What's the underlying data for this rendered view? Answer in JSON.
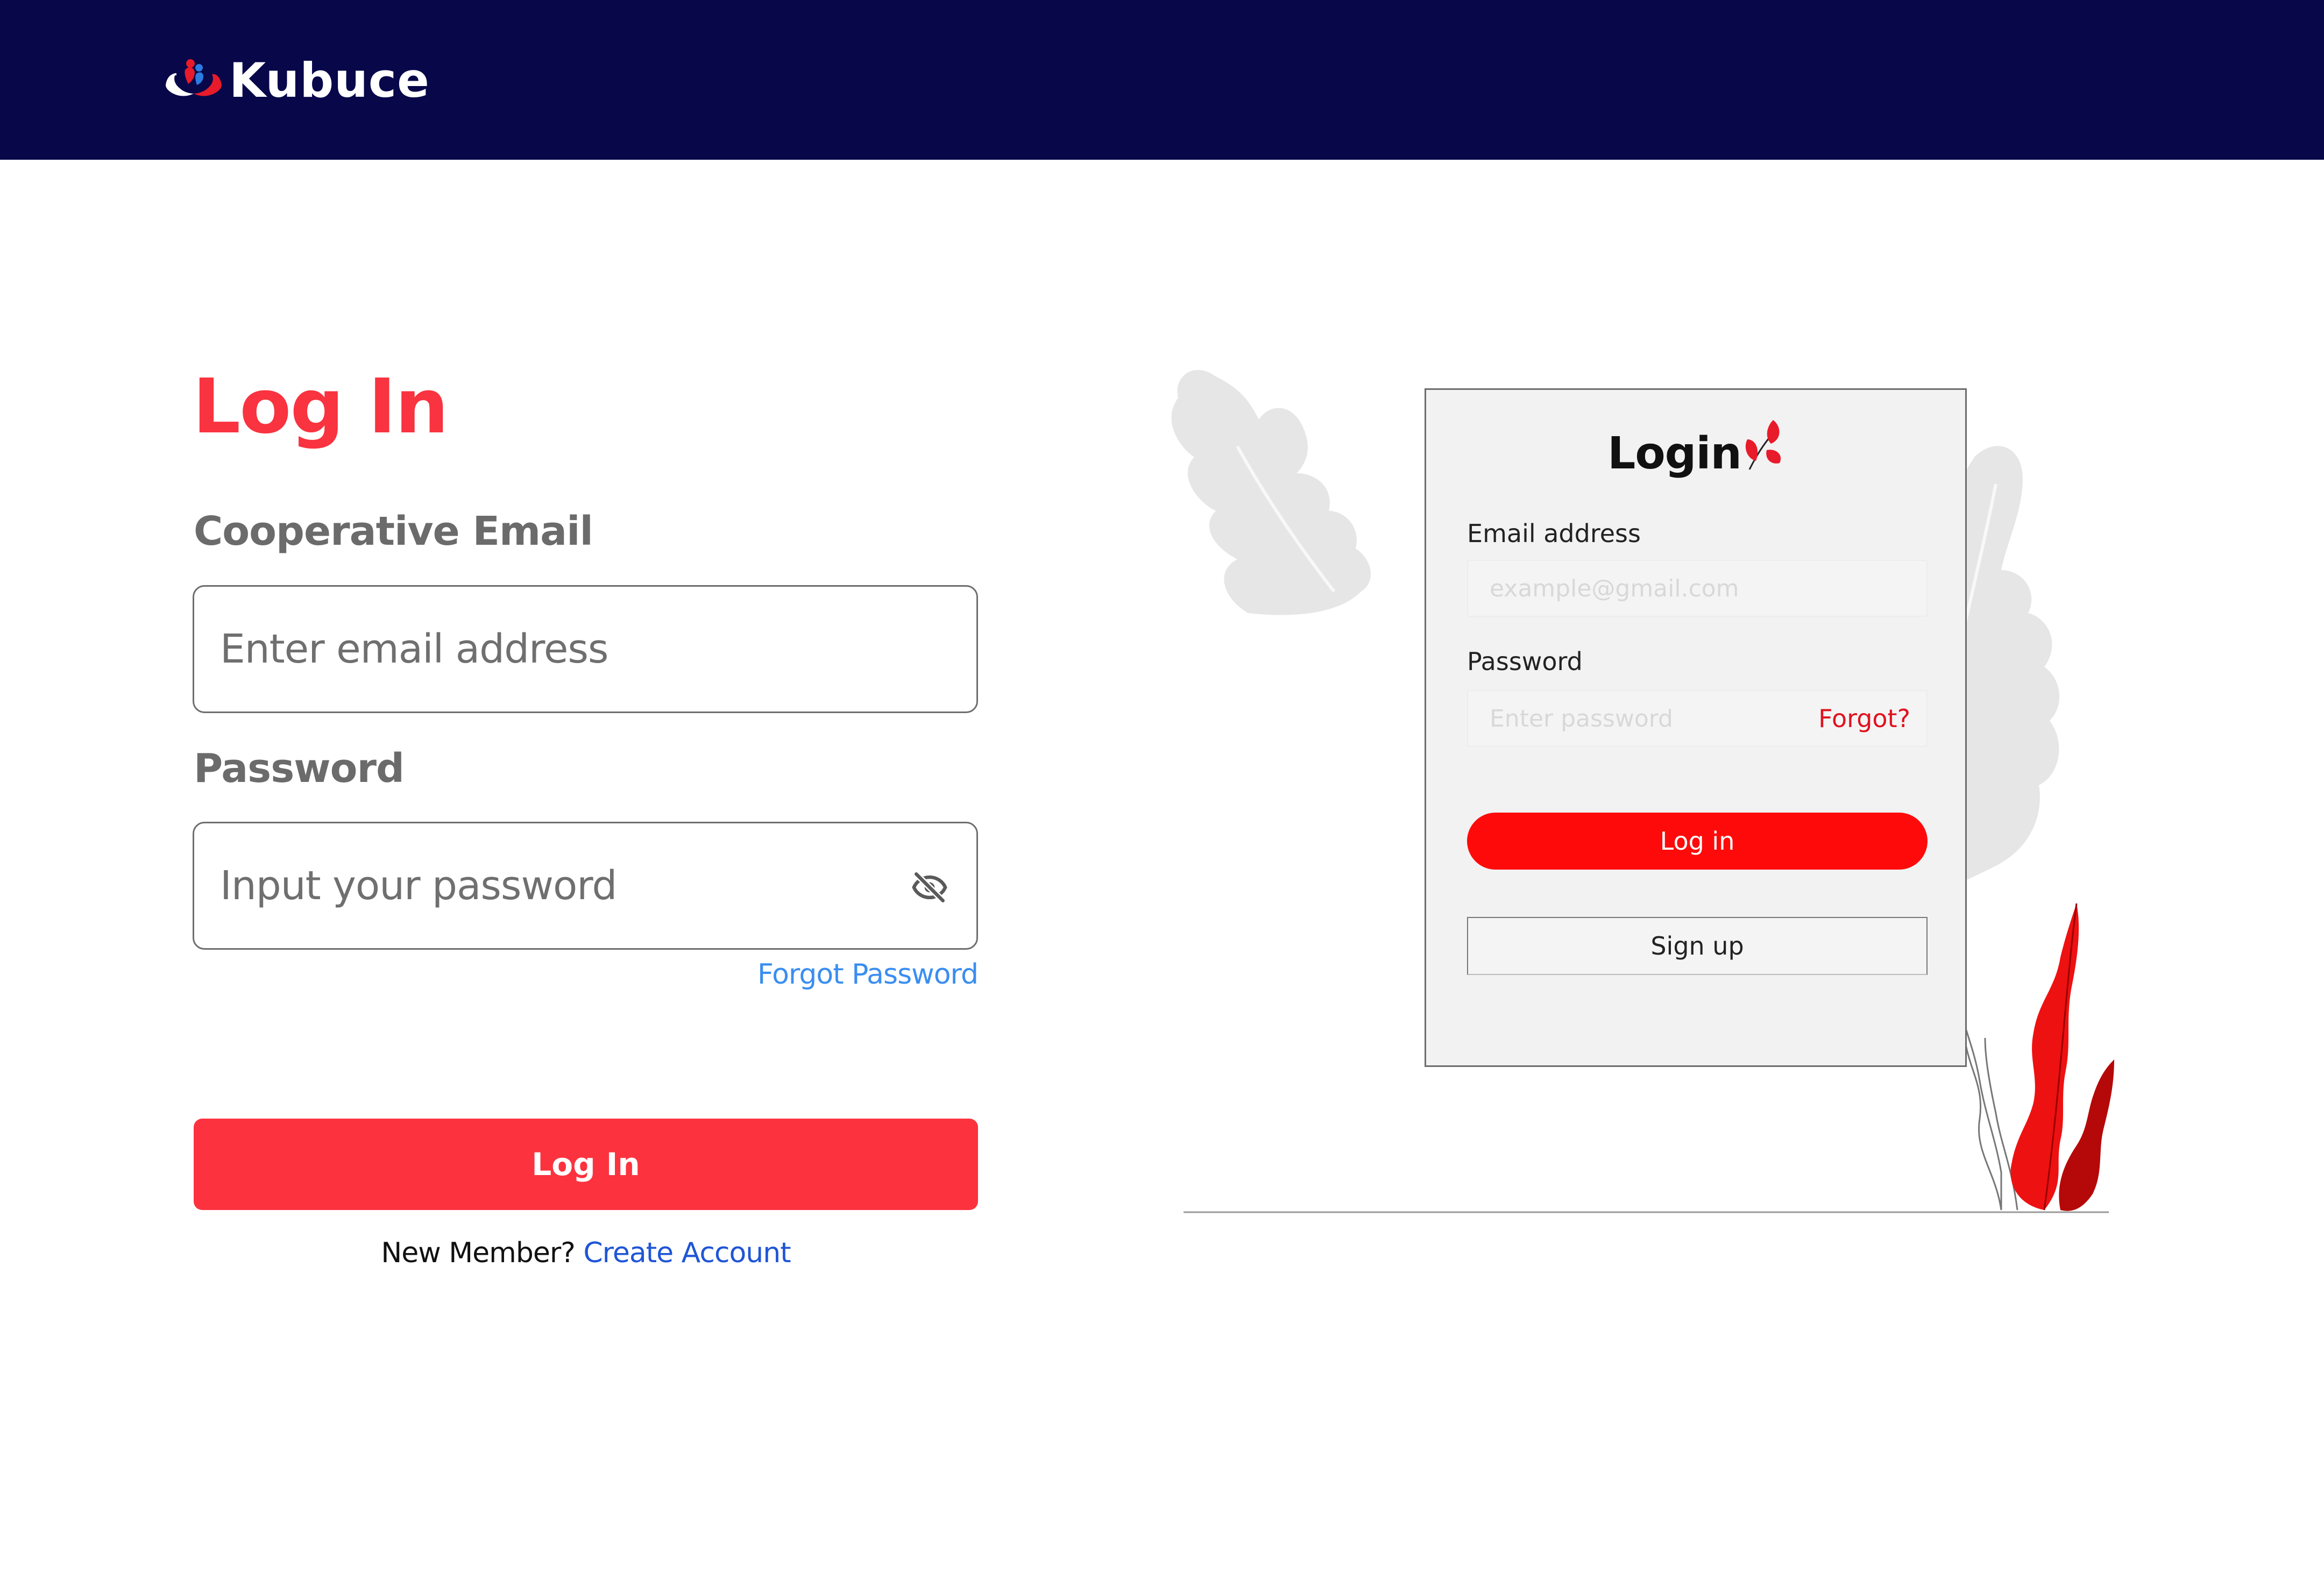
{
  "header": {
    "brand_name": "Kubuce",
    "background_color": "#07074a"
  },
  "form": {
    "title": "Log In",
    "email_label": "Cooperative Email",
    "email_placeholder": "Enter email address",
    "password_label": "Password",
    "password_placeholder": "Input your password",
    "password_toggle_icon": "eye-off-icon",
    "forgot_password": "Forgot Password",
    "submit_label": "Log In",
    "new_member_text": "New Member?",
    "create_account": "Create Account",
    "accent_color": "#fc333f",
    "link_color": "#1f55d6"
  },
  "illustration": {
    "card_title": "Login",
    "email_label": "Email address",
    "email_placeholder": "example@gmail.com",
    "password_label": "Password",
    "password_placeholder": "Enter password",
    "forgot": "Forgot?",
    "login_button": "Log in",
    "signup_button": "Sign up",
    "accent_color": "#ff0a0a"
  }
}
